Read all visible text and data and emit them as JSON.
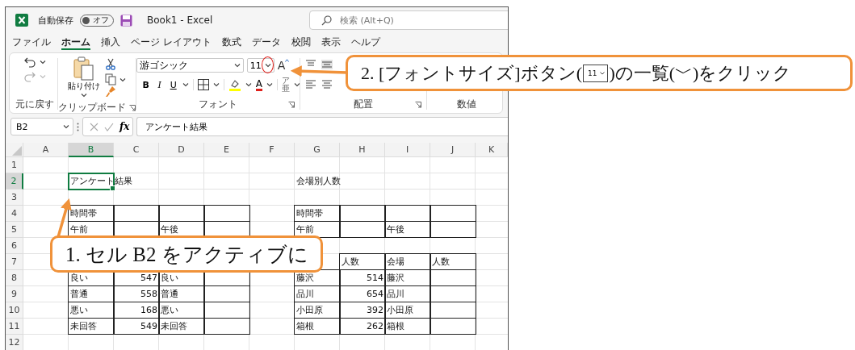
{
  "title_bar": {
    "autosave_label": "自動保存",
    "autosave": {
      "on": false,
      "label": "オフ"
    },
    "document_title": "Book1  -  Excel",
    "search": {
      "placeholder": "検索 (Alt+Q)"
    }
  },
  "tabs": [
    {
      "label": "ファイル",
      "selected": false
    },
    {
      "label": "ホーム",
      "selected": true
    },
    {
      "label": "挿入",
      "selected": false
    },
    {
      "label": "ページ レイアウト",
      "selected": false
    },
    {
      "label": "数式",
      "selected": false
    },
    {
      "label": "データ",
      "selected": false
    },
    {
      "label": "校閲",
      "selected": false
    },
    {
      "label": "表示",
      "selected": false
    },
    {
      "label": "ヘルプ",
      "selected": false
    }
  ],
  "ribbon": {
    "undo_group_label": "元に戻す",
    "clipboard": {
      "paste_label": "貼り付け",
      "group_label": "クリップボード"
    },
    "font": {
      "font_name": "游ゴシック",
      "font_size": "11",
      "grow_label": "A",
      "style_buttons": [
        "B",
        "I",
        "U"
      ],
      "font_color_label": "A",
      "phonetic": [
        "ア",
        "亜"
      ],
      "group_label": "フォント"
    },
    "alignment_label": "配置",
    "number_label": "数値"
  },
  "formula_bar": {
    "name_box": "B2",
    "fx": "fx",
    "value": "アンケート結果"
  },
  "sheet": {
    "columns": [
      "A",
      "B",
      "C",
      "D",
      "E",
      "F",
      "G",
      "H",
      "I",
      "J",
      "K"
    ],
    "rows": [
      {
        "number": "1",
        "cells": []
      },
      {
        "number": "2",
        "cells": [
          null,
          {
            "text": "アンケート結果",
            "bordered": false,
            "numeric": false,
            "selected": true
          },
          null,
          null,
          null,
          null,
          {
            "text": "会場別人数",
            "bordered": false,
            "numeric": false,
            "selected": false
          }
        ]
      },
      {
        "number": "3",
        "cells": []
      },
      {
        "number": "4",
        "cells": [
          null,
          {
            "text": "時間帯",
            "bordered": true,
            "numeric": false,
            "selected": false
          },
          {
            "bordered": true,
            "numeric": false,
            "selected": false
          },
          {
            "bordered": true,
            "numeric": false,
            "selected": false
          },
          {
            "bordered": true,
            "numeric": false,
            "selected": false
          },
          null,
          {
            "text": "時間帯",
            "bordered": true,
            "numeric": false,
            "selected": false
          },
          {
            "bordered": true,
            "numeric": false,
            "selected": false
          },
          {
            "bordered": true,
            "numeric": false,
            "selected": false
          },
          {
            "bordered": true,
            "numeric": false,
            "selected": false
          }
        ]
      },
      {
        "number": "5",
        "cells": [
          null,
          {
            "text": "午前",
            "bordered": true,
            "numeric": false,
            "selected": false
          },
          {
            "bordered": true,
            "numeric": false,
            "selected": false
          },
          {
            "text": "午後",
            "bordered": true,
            "numeric": false,
            "selected": false
          },
          {
            "bordered": true,
            "numeric": false,
            "selected": false
          },
          null,
          {
            "text": "午前",
            "bordered": true,
            "numeric": false,
            "selected": false
          },
          {
            "bordered": true,
            "numeric": false,
            "selected": false
          },
          {
            "text": "午後",
            "bordered": true,
            "numeric": false,
            "selected": false
          },
          {
            "bordered": true,
            "numeric": false,
            "selected": false
          }
        ]
      },
      {
        "number": "6",
        "cells": []
      },
      {
        "number": "7",
        "cells": [
          null,
          null,
          null,
          null,
          null,
          null,
          null,
          {
            "text": "人数",
            "bordered": true,
            "numeric": false,
            "selected": false
          },
          {
            "text": "会場",
            "bordered": true,
            "numeric": false,
            "selected": false
          },
          {
            "text": "人数",
            "bordered": true,
            "numeric": false,
            "selected": false
          }
        ]
      },
      {
        "number": "8",
        "cells": [
          null,
          {
            "text": "良い",
            "bordered": true,
            "numeric": false,
            "selected": false
          },
          {
            "text": "547",
            "bordered": true,
            "numeric": true,
            "selected": false
          },
          {
            "text": "良い",
            "bordered": true,
            "numeric": false,
            "selected": false
          },
          {
            "bordered": true,
            "numeric": false,
            "selected": false
          },
          null,
          {
            "text": "藤沢",
            "bordered": true,
            "numeric": false,
            "selected": false
          },
          {
            "text": "514",
            "bordered": true,
            "numeric": true,
            "selected": false
          },
          {
            "text": "藤沢",
            "bordered": true,
            "numeric": false,
            "selected": false
          },
          {
            "bordered": true,
            "numeric": false,
            "selected": false
          }
        ]
      },
      {
        "number": "9",
        "cells": [
          null,
          {
            "text": "普通",
            "bordered": true,
            "numeric": false,
            "selected": false
          },
          {
            "text": "558",
            "bordered": true,
            "numeric": true,
            "selected": false
          },
          {
            "text": "普通",
            "bordered": true,
            "numeric": false,
            "selected": false
          },
          {
            "bordered": true,
            "numeric": false,
            "selected": false
          },
          null,
          {
            "text": "品川",
            "bordered": true,
            "numeric": false,
            "selected": false
          },
          {
            "text": "654",
            "bordered": true,
            "numeric": true,
            "selected": false
          },
          {
            "text": "品川",
            "bordered": true,
            "numeric": false,
            "selected": false
          },
          {
            "bordered": true,
            "numeric": false,
            "selected": false
          }
        ]
      },
      {
        "number": "10",
        "cells": [
          null,
          {
            "text": "悪い",
            "bordered": true,
            "numeric": false,
            "selected": false
          },
          {
            "text": "168",
            "bordered": true,
            "numeric": true,
            "selected": false
          },
          {
            "text": "悪い",
            "bordered": true,
            "numeric": false,
            "selected": false
          },
          {
            "bordered": true,
            "numeric": false,
            "selected": false
          },
          null,
          {
            "text": "小田原",
            "bordered": true,
            "numeric": false,
            "selected": false
          },
          {
            "text": "392",
            "bordered": true,
            "numeric": true,
            "selected": false
          },
          {
            "text": "小田原",
            "bordered": true,
            "numeric": false,
            "selected": false
          },
          {
            "bordered": true,
            "numeric": false,
            "selected": false
          }
        ]
      },
      {
        "number": "11",
        "cells": [
          null,
          {
            "text": "未回答",
            "bordered": true,
            "numeric": false,
            "selected": false
          },
          {
            "text": "549",
            "bordered": true,
            "numeric": true,
            "selected": false
          },
          {
            "text": "未回答",
            "bordered": true,
            "numeric": false,
            "selected": false
          },
          {
            "bordered": true,
            "numeric": false,
            "selected": false
          },
          null,
          {
            "text": "箱根",
            "bordered": true,
            "numeric": false,
            "selected": false
          },
          {
            "text": "262",
            "bordered": true,
            "numeric": true,
            "selected": false
          },
          {
            "text": "箱根",
            "bordered": true,
            "numeric": false,
            "selected": false
          },
          {
            "bordered": true,
            "numeric": false,
            "selected": false
          }
        ]
      },
      {
        "number": "12",
        "cells": []
      }
    ]
  },
  "callout_1": {
    "text": "1. セル B2 をアクティブに"
  },
  "callout_2": {
    "before": "2. [フォントサイズ]ボタン(",
    "inline_box": "11",
    "after": ")の一覧(﹀)をクリック"
  }
}
